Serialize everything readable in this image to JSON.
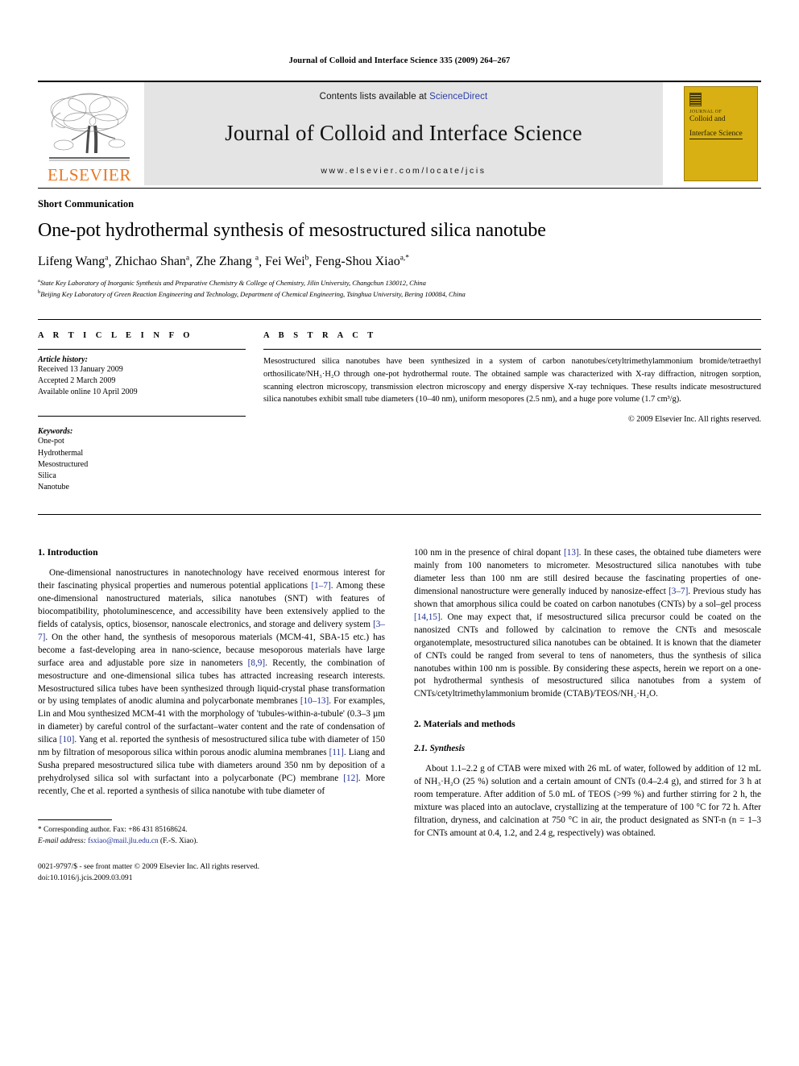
{
  "running_head": "Journal of Colloid and Interface Science 335 (2009) 264–267",
  "masthead": {
    "publisher_name": "ELSEVIER",
    "contents_prefix": "Contents lists available at ",
    "sciencedirect": "ScienceDirect",
    "journal_title": "Journal of Colloid and Interface Science",
    "journal_url": "www.elsevier.com/locate/jcis",
    "cover": {
      "line1": "JOURNAL OF",
      "line2": "Colloid and",
      "line3": "Interface Science"
    },
    "colors": {
      "banner_bg": "#e4e4e4",
      "elsevier_orange": "#E87722",
      "cover_yellow": "#d8b013",
      "link_blue": "#2b3ea8"
    }
  },
  "article": {
    "doctype": "Short Communication",
    "title": "One-pot hydrothermal synthesis of mesostructured silica nanotube",
    "authors": [
      {
        "name": "Lifeng Wang",
        "sup": "a"
      },
      {
        "name": "Zhichao Shan",
        "sup": "a"
      },
      {
        "name": "Zhe Zhang",
        "sup": "a"
      },
      {
        "name": "Fei Wei",
        "sup": "b"
      },
      {
        "name": "Feng-Shou Xiao",
        "sup": "a,*"
      }
    ],
    "affiliations": [
      {
        "mark": "a",
        "text": "State Key Laboratory of Inorganic Synthesis and Preparative Chemistry & College of Chemistry, Jilin University, Changchun 130012, China"
      },
      {
        "mark": "b",
        "text": "Beijing Key Laboratory of Green Reaction Engineering and Technology, Department of Chemical Engineering, Tsinghua University, Bering 100084, China"
      }
    ]
  },
  "article_info": {
    "heading": "A R T I C L E    I N F O",
    "history_title": "Article history:",
    "history": [
      "Received 13 January 2009",
      "Accepted 2 March 2009",
      "Available online 10 April 2009"
    ],
    "keywords_title": "Keywords:",
    "keywords": [
      "One-pot",
      "Hydrothermal",
      "Mesostructured",
      "Silica",
      "Nanotube"
    ]
  },
  "abstract": {
    "heading": "A B S T R A C T",
    "text": "Mesostructured silica nanotubes have been synthesized in a system of carbon nanotubes/cetyltrimethylammonium bromide/tetraethyl orthosilicate/NH₃·H₂O through one-pot hydrothermal route. The obtained sample was characterized with X-ray diffraction, nitrogen sorption, scanning electron microscopy, transmission electron microscopy and energy dispersive X-ray techniques. These results indicate mesostructured silica nanotubes exhibit small tube diameters (10–40 nm), uniform mesopores (2.5 nm), and a huge pore volume (1.7 cm³/g).",
    "copyright": "© 2009 Elsevier Inc. All rights reserved."
  },
  "body": {
    "intro_heading": "1. Introduction",
    "intro_p1_a": "One-dimensional nanostructures in nanotechnology have received enormous interest for their fascinating physical properties and numerous potential applications ",
    "intro_cite1": "[1–7]",
    "intro_p1_b": ". Among these one-dimensional nanostructured materials, silica nanotubes (SNT) with features of biocompatibility, photoluminescence, and accessibility have been extensively applied to the fields of catalysis, optics, biosensor, nanoscale electronics, and storage and delivery system ",
    "intro_cite2": "[3–7]",
    "intro_p1_c": ". On the other hand, the synthesis of mesoporous materials (MCM-41, SBA-15 etc.) has become a fast-developing area in nano-science, because mesoporous materials have large surface area and adjustable pore size in nanometers ",
    "intro_cite3": "[8,9]",
    "intro_p1_d": ". Recently, the combination of mesostructure and one-dimensional silica tubes has attracted increasing research interests. Mesostructured silica tubes have been synthesized through liquid-crystal phase transformation or by using templates of anodic alumina and polycarbonate membranes ",
    "intro_cite4": "[10–13]",
    "intro_p1_e": ". For examples, Lin and Mou synthesized MCM-41 with the morphology of 'tubules-within-a-tubule' (0.3–3 µm in diameter) by careful control of the surfactant–water content and the rate of condensation of silica ",
    "intro_cite5": "[10]",
    "intro_p1_f": ". Yang et al. reported the synthesis of mesostructured silica tube with diameter of 150 nm by filtration of mesoporous silica within porous anodic alumina membranes ",
    "intro_cite6": "[11]",
    "intro_p1_g": ". Liang and Susha prepared mesostructured silica tube with diameters around 350 nm by deposition of a prehydrolysed silica sol with surfactant into a polycarbonate (PC) membrane ",
    "intro_cite7": "[12]",
    "intro_p1_h": ". More recently, Che et al. reported a synthesis of silica nanotube with tube diameter of ",
    "right_p1_a": "100 nm in the presence of chiral dopant ",
    "right_cite1": "[13]",
    "right_p1_b": ". In these cases, the obtained tube diameters were mainly from 100 nanometers to micrometer. Mesostructured silica nanotubes with tube diameter less than 100 nm are still desired because the fascinating properties of one-dimensional nanostructure were generally induced by nanosize-effect ",
    "right_cite2": "[3–7]",
    "right_p1_c": ". Previous study has shown that amorphous silica could be coated on carbon nanotubes (CNTs) by a sol–gel process ",
    "right_cite3": "[14,15]",
    "right_p1_d": ". One may expect that, if mesostructured silica precursor could be coated on the nanosized CNTs and followed by calcination to remove the CNTs and mesoscale organotemplate, mesostructured silica nanotubes can be obtained. It is known that the diameter of CNTs could be ranged from several to tens of nanometers, thus the synthesis of silica nanotubes within 100 nm is possible. By considering these aspects, herein we report on a one-pot hydrothermal synthesis of mesostructured silica nanotubes from a system of CNTs/cetyltrimethylammonium bromide (CTAB)/TEOS/NH₃·H₂O.",
    "methods_heading": "2. Materials and methods",
    "synthesis_heading": "2.1. Synthesis",
    "synthesis_p1": "About 1.1–2.2 g of CTAB were mixed with 26 mL of water, followed by addition of 12 mL of NH₃·H₂O (25 %) solution and a certain amount of CNTs (0.4–2.4 g), and stirred for 3 h at room temperature. After addition of 5.0 mL of TEOS (>99 %) and further stirring for 2 h, the mixture was placed into an autoclave, crystallizing at the temperature of 100 °C for 72 h. After filtration, dryness, and calcination at 750 °C in air, the product designated as SNT-n (n = 1–3 for CNTs amount at 0.4, 1.2, and 2.4 g, respectively) was obtained."
  },
  "footer": {
    "corr_marker": "*",
    "corr_text": "Corresponding author. Fax: +86 431 85168624.",
    "email_label": "E-mail address:",
    "email": "fsxiao@mail.jlu.edu.cn",
    "email_suffix": "(F.-S. Xiao).",
    "imprint_line1": "0021-9797/$ - see front matter © 2009 Elsevier Inc. All rights reserved.",
    "imprint_line2": "doi:10.1016/j.jcis.2009.03.091"
  }
}
